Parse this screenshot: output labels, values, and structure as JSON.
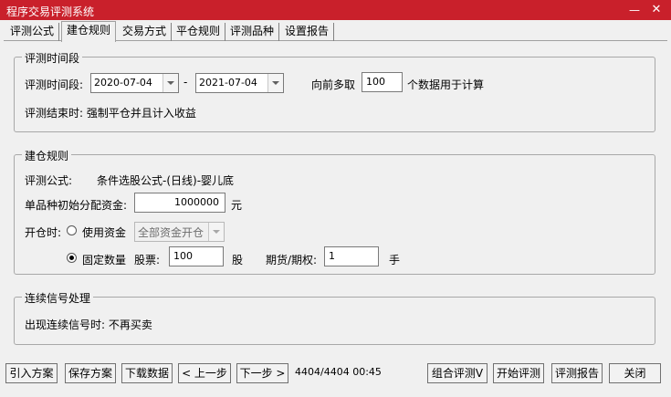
{
  "window": {
    "title": "程序交易评测系统",
    "minimize": "—",
    "close": "✕"
  },
  "tabs": [
    "评测公式",
    "建仓规则",
    "交易方式",
    "平仓规则",
    "评测品种",
    "设置报告"
  ],
  "period": {
    "group_title": "评测时间段",
    "label": "评测时间段:",
    "start_date": "2020-07-04",
    "separator": "-",
    "end_date": "2021-07-04",
    "lookback_prefix": "向前多取",
    "lookback_value": "100",
    "lookback_suffix": "个数据用于计算",
    "end_label": "评测结束时: 强制平仓并且计入收益"
  },
  "entry": {
    "group_title": "建仓规则",
    "formula_label": "评测公式:",
    "formula_value": "条件选股公式-(日线)-婴儿底",
    "capital_label": "单品种初始分配资金:",
    "capital_value": "1000000",
    "capital_unit": "元",
    "open_label": "开仓时:",
    "use_capital_label": "使用资金",
    "use_capital_select": "全部资金开仓",
    "fixed_qty_label": "固定数量",
    "stock_label": "股票:",
    "stock_value": "100",
    "stock_unit": "股",
    "futures_label": "期货/期权:",
    "futures_value": "1",
    "futures_unit": "手",
    "selected_mode": "fixed_qty"
  },
  "signal": {
    "group_title": "连续信号处理",
    "text": "出现连续信号时: 不再买卖"
  },
  "buttons": {
    "import": "引入方案",
    "save": "保存方案",
    "download": "下载数据",
    "prev": "< 上一步",
    "next": "下一步 >",
    "combo_eval": "组合评测V",
    "start_eval": "开始评测",
    "report": "评测报告",
    "close": "关闭"
  },
  "status": "4404/4404 00:45",
  "colors": {
    "titlebar": "#c9202b",
    "background": "#f0f0f0"
  }
}
